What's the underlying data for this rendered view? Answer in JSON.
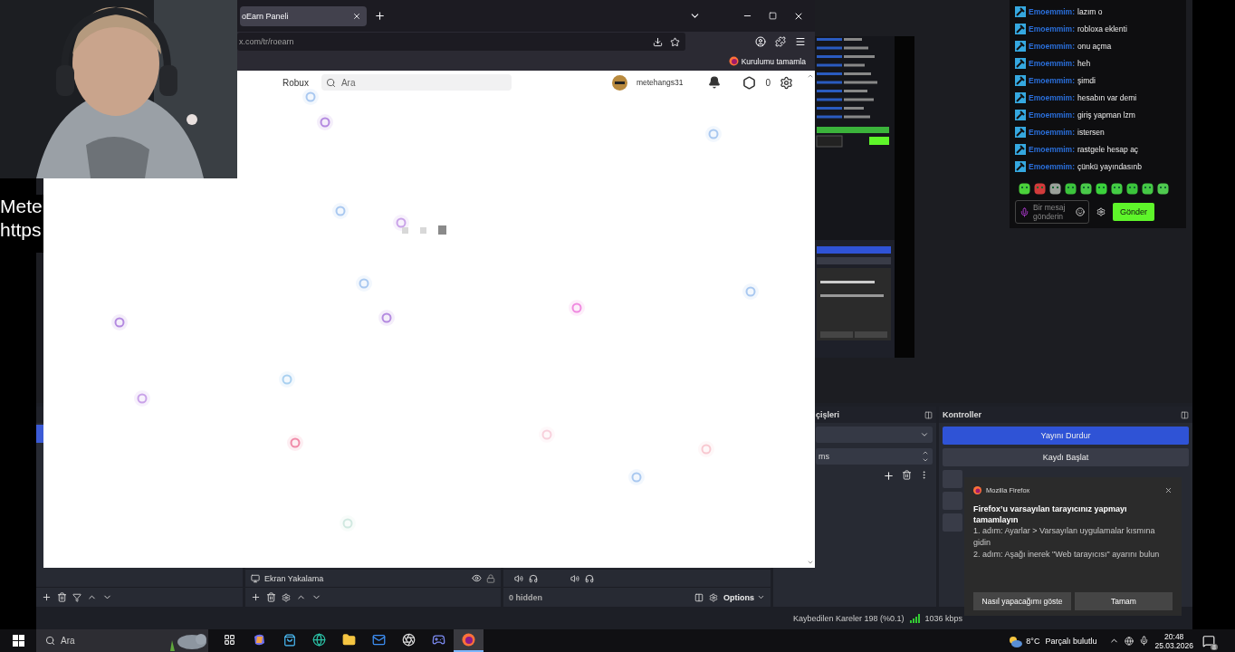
{
  "behind_window": {
    "lines": [
      "Mete",
      "https"
    ]
  },
  "obs": {
    "chat": {
      "messages": [
        {
          "user": "Emoemmim:",
          "text": "lazım o"
        },
        {
          "user": "Emoemmim:",
          "text": "robloxa eklenti"
        },
        {
          "user": "Emoemmim:",
          "text": "onu açma"
        },
        {
          "user": "Emoemmim:",
          "text": "heh"
        },
        {
          "user": "Emoemmim:",
          "text": "şimdi"
        },
        {
          "user": "Emoemmim:",
          "text": "hesabın var demi"
        },
        {
          "user": "Emoemmim:",
          "text": "giriş yapman lzm"
        },
        {
          "user": "Emoemmim:",
          "text": "istersen"
        },
        {
          "user": "Emoemmim:",
          "text": "rastgele hesap aç"
        },
        {
          "user": "Emoemmim:",
          "text": "çünkü yayındasınb"
        }
      ],
      "input_placeholder": "Bir mesaj gönderin",
      "send_button": "Gönder"
    },
    "scenes": [
      {
        "selected": true
      }
    ],
    "sources": [
      {
        "name": "Ekran Yakalama",
        "visible": true,
        "locked": true
      }
    ],
    "mixer": {
      "hidden_label": "0 hidden",
      "options_button": "Options"
    },
    "transitions": {
      "title": "çişleri",
      "duration_unit": "ms"
    },
    "controls": {
      "title": "Kontroller",
      "buttons": [
        {
          "label": "Yayını Durdur",
          "active": true
        },
        {
          "label": "Kaydı Başlat",
          "active": false
        }
      ]
    },
    "status_bar": {
      "dropped_frames": "Kaybedilen Kareler 198 (%0.1)",
      "bitrate": "1036 kbps"
    }
  },
  "browser": {
    "tabs": [
      {
        "title": "oEarn Paneli",
        "selected": true
      }
    ],
    "url": "x.com/tr/roearn",
    "setup_prompt": "Kurulumu tamamla",
    "site": {
      "nav_link": "Robux",
      "search_placeholder": "Ara",
      "username": "metehangs31",
      "robux_balance": "0"
    }
  },
  "notification": {
    "app": "Mozilla Firefox",
    "title": "Firefox’u varsayılan tarayıcınız yapmayı tamamlayın",
    "steps": [
      "1. adım: Ayarlar > Varsayılan uygulamalar kısmına gidin",
      "2. adım: Aşağı inerek \"Web tarayıcısı\" ayarını bulun"
    ],
    "buttons": [
      "Nasıl yapacağımı göste",
      "Tamam"
    ]
  },
  "taskbar": {
    "search_placeholder": "Ara",
    "apps": [
      {
        "selected": false
      },
      {
        "selected": false
      },
      {
        "selected": false
      },
      {
        "selected": false
      },
      {
        "selected": false
      },
      {
        "selected": false
      },
      {
        "selected": false
      },
      {
        "selected": false
      },
      {
        "selected": true
      }
    ],
    "weather": {
      "temperature": "8°C",
      "condition": "Parçalı bulutlu"
    },
    "time": "20:48",
    "date": "25.03.2026",
    "notification_count": "8"
  }
}
